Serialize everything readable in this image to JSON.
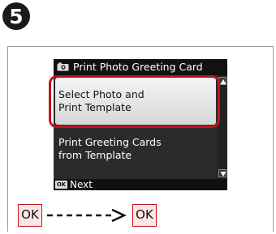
{
  "step": {
    "number": "5"
  },
  "screen": {
    "title": "Print Photo Greeting Card",
    "menu_items": [
      {
        "label_line1": "Select Photo and",
        "label_line2": "Print Template",
        "selected": true
      },
      {
        "label_line1": "Print Greeting Cards",
        "label_line2": "from Template",
        "selected": false
      }
    ],
    "footer": {
      "button": "OK",
      "label": "Next"
    }
  },
  "instruction": {
    "first_press": "OK",
    "second_press": "OK"
  },
  "colors": {
    "highlight": "#c4121c",
    "lcd_background": "#2b2b2b",
    "title_bar": "#111111"
  },
  "icons": [
    "camera-icon",
    "scroll-up-icon",
    "scroll-down-icon",
    "arrow-right-icon"
  ]
}
